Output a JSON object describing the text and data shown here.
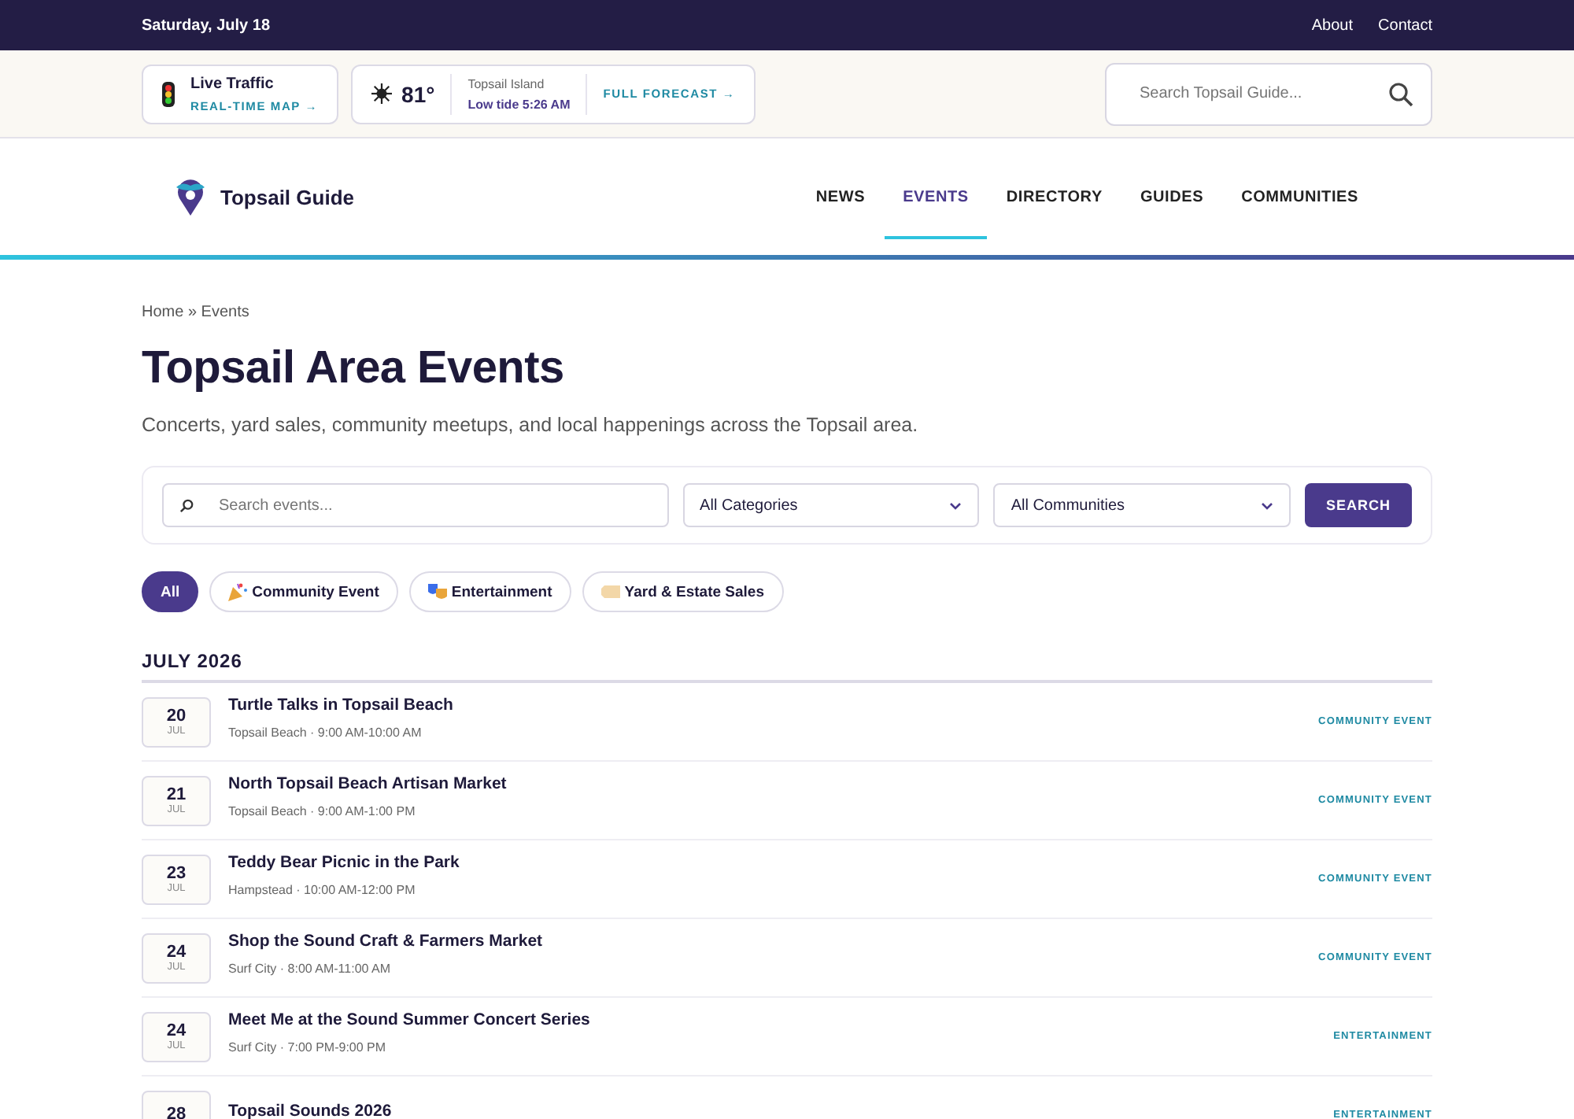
{
  "top_bar": {
    "date": "Saturday, July 18",
    "links": [
      "About",
      "Contact"
    ]
  },
  "traffic": {
    "title": "Live Traffic",
    "link": "REAL-TIME MAP →"
  },
  "weather": {
    "temp": "81°",
    "place": "Topsail Island",
    "tide": "Low tide 5:26 AM",
    "link": "FULL FORECAST →"
  },
  "site_search": {
    "placeholder": "Search Topsail Guide..."
  },
  "logo": "Topsail Guide",
  "nav": [
    {
      "label": "NEWS",
      "selected": false
    },
    {
      "label": "EVENTS",
      "selected": true
    },
    {
      "label": "DIRECTORY",
      "selected": false
    },
    {
      "label": "GUIDES",
      "selected": false
    },
    {
      "label": "COMMUNITIES",
      "selected": false
    }
  ],
  "breadcrumb": "Home » Events",
  "title": "Topsail Area Events",
  "subtitle": "Concerts, yard sales, community meetups, and local happenings across the Topsail area.",
  "filters": {
    "search_placeholder": "Search events...",
    "category": "All Categories",
    "community": "All Communities",
    "button": "SEARCH"
  },
  "chips": [
    {
      "label": "All",
      "kind": "plain",
      "selected": true
    },
    {
      "label": "Community Event",
      "kind": "party",
      "selected": false
    },
    {
      "label": "Entertainment",
      "kind": "masks",
      "selected": false
    },
    {
      "label": "Yard & Estate Sales",
      "kind": "tag",
      "selected": false
    }
  ],
  "month": "JULY 2026",
  "events": [
    {
      "day": "20",
      "month": "JUL",
      "title": "Turtle Talks in Topsail Beach",
      "meta": "Topsail Beach · 9:00 AM-10:00 AM",
      "category": "COMMUNITY EVENT"
    },
    {
      "day": "21",
      "month": "JUL",
      "title": "North Topsail Beach Artisan Market",
      "meta": "Topsail Beach · 9:00 AM-1:00 PM",
      "category": "COMMUNITY EVENT"
    },
    {
      "day": "23",
      "month": "JUL",
      "title": "Teddy Bear Picnic in the Park",
      "meta": "Hampstead · 10:00 AM-12:00 PM",
      "category": "COMMUNITY EVENT"
    },
    {
      "day": "24",
      "month": "JUL",
      "title": "Shop the Sound Craft & Farmers Market",
      "meta": "Surf City · 8:00 AM-11:00 AM",
      "category": "COMMUNITY EVENT"
    },
    {
      "day": "24",
      "month": "JUL",
      "title": "Meet Me at the Sound Summer Concert Series",
      "meta": "Surf City · 7:00 PM-9:00 PM",
      "category": "ENTERTAINMENT"
    },
    {
      "day": "28",
      "title": "Topsail Sounds 2026",
      "category": "ENTERTAINMENT"
    }
  ]
}
